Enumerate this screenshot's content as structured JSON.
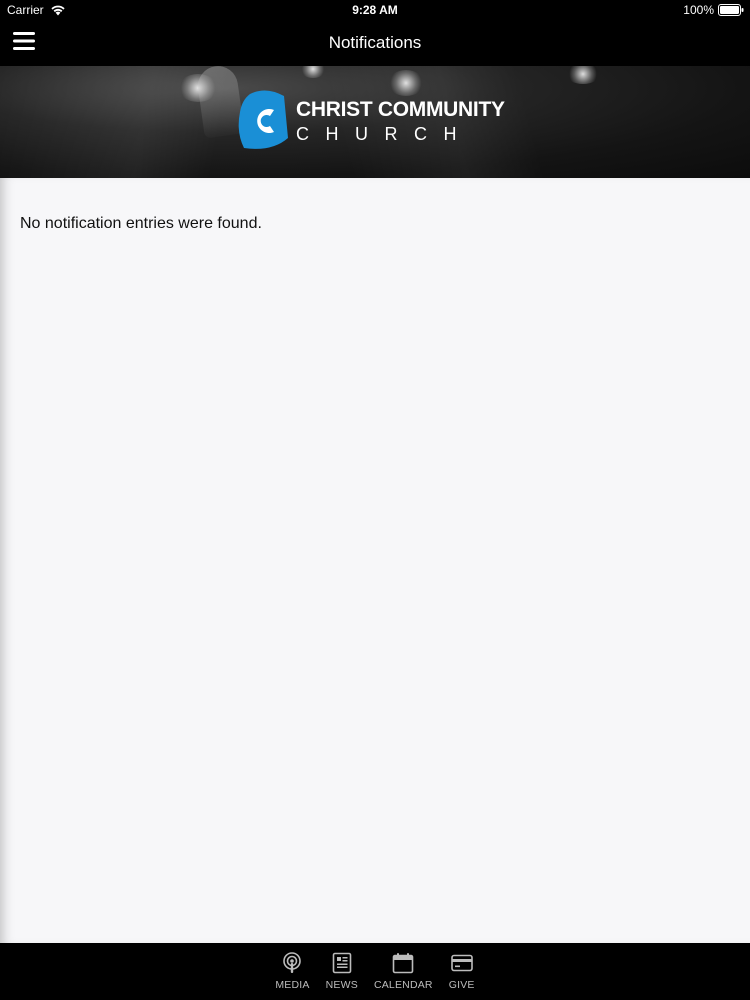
{
  "status_bar": {
    "carrier": "Carrier",
    "time": "9:28 AM",
    "battery_percent": "100%",
    "battery_level": 1.0
  },
  "nav": {
    "title": "Notifications",
    "menu_icon": "hamburger-menu-icon"
  },
  "banner": {
    "logo_line1": "CHRIST COMMUNITY",
    "logo_line2": "CHURCH",
    "logo_color": "#1a8fd6"
  },
  "content": {
    "empty_message": "No notification entries were found."
  },
  "tab_bar": {
    "items": [
      {
        "label": "MEDIA",
        "icon": "podcast-icon"
      },
      {
        "label": "NEWS",
        "icon": "news-icon"
      },
      {
        "label": "CALENDAR",
        "icon": "calendar-icon"
      },
      {
        "label": "GIVE",
        "icon": "credit-card-icon"
      }
    ]
  },
  "colors": {
    "bar_background": "#000000",
    "content_background": "#f7f7f9",
    "tab_label": "#bcbcbc"
  }
}
